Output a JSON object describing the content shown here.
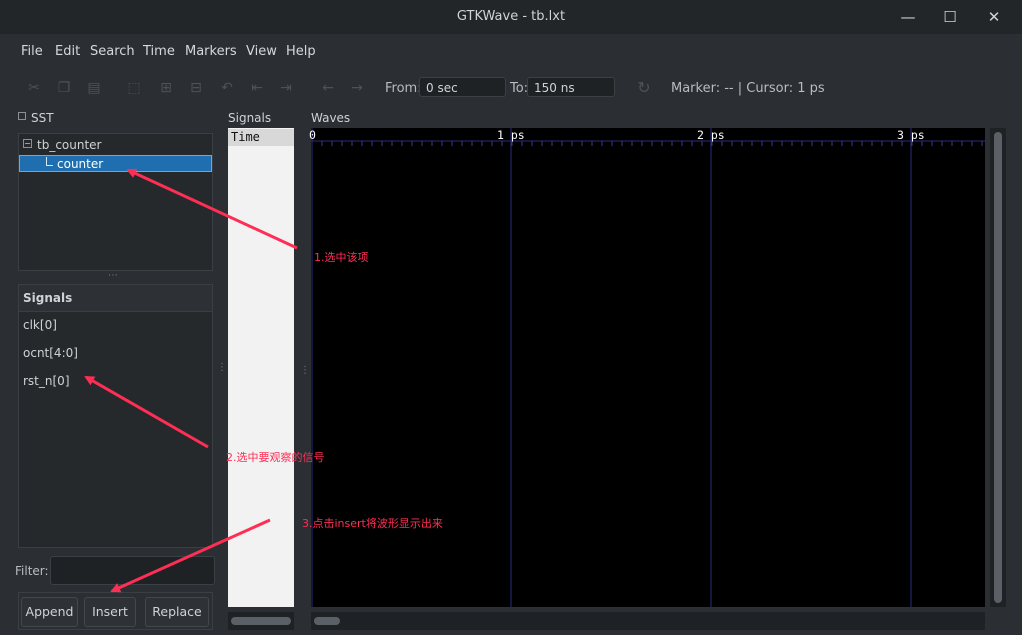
{
  "window": {
    "title": "GTKWave - tb.lxt",
    "min": "—",
    "max": "☐",
    "close": "✕"
  },
  "menu": [
    "File",
    "Edit",
    "Search",
    "Time",
    "Markers",
    "View",
    "Help"
  ],
  "toolbar": {
    "from_label": "From:",
    "from_value": "0 sec",
    "to_label": "To:",
    "to_value": "150 ns",
    "status": "Marker: --  |  Cursor: 1 ps"
  },
  "sst": {
    "title": "SST",
    "tree": {
      "root": "tb_counter",
      "child": "counter"
    },
    "grip": "⋯",
    "signals_header": "Signals",
    "signals": [
      "clk[0]",
      "ocnt[4:0]",
      "rst_n[0]"
    ],
    "filter_label": "Filter:",
    "buttons": {
      "append": "Append",
      "insert": "Insert",
      "replace": "Replace"
    }
  },
  "signals_panel": {
    "title": "Signals",
    "time_header": "Time"
  },
  "waves_panel": {
    "title": "Waves",
    "ruler": [
      "0",
      "1 ps",
      "2 ps",
      "3 ps"
    ]
  },
  "annotations": {
    "step1": "1.选中该项",
    "step2": "2.选中要观察的信号",
    "step3": "3.点击insert将波形显示出来"
  },
  "colors": {
    "annotation": "#ff2e55",
    "selection": "#1f6fb0",
    "wave_grid": "#2a2a7a"
  }
}
